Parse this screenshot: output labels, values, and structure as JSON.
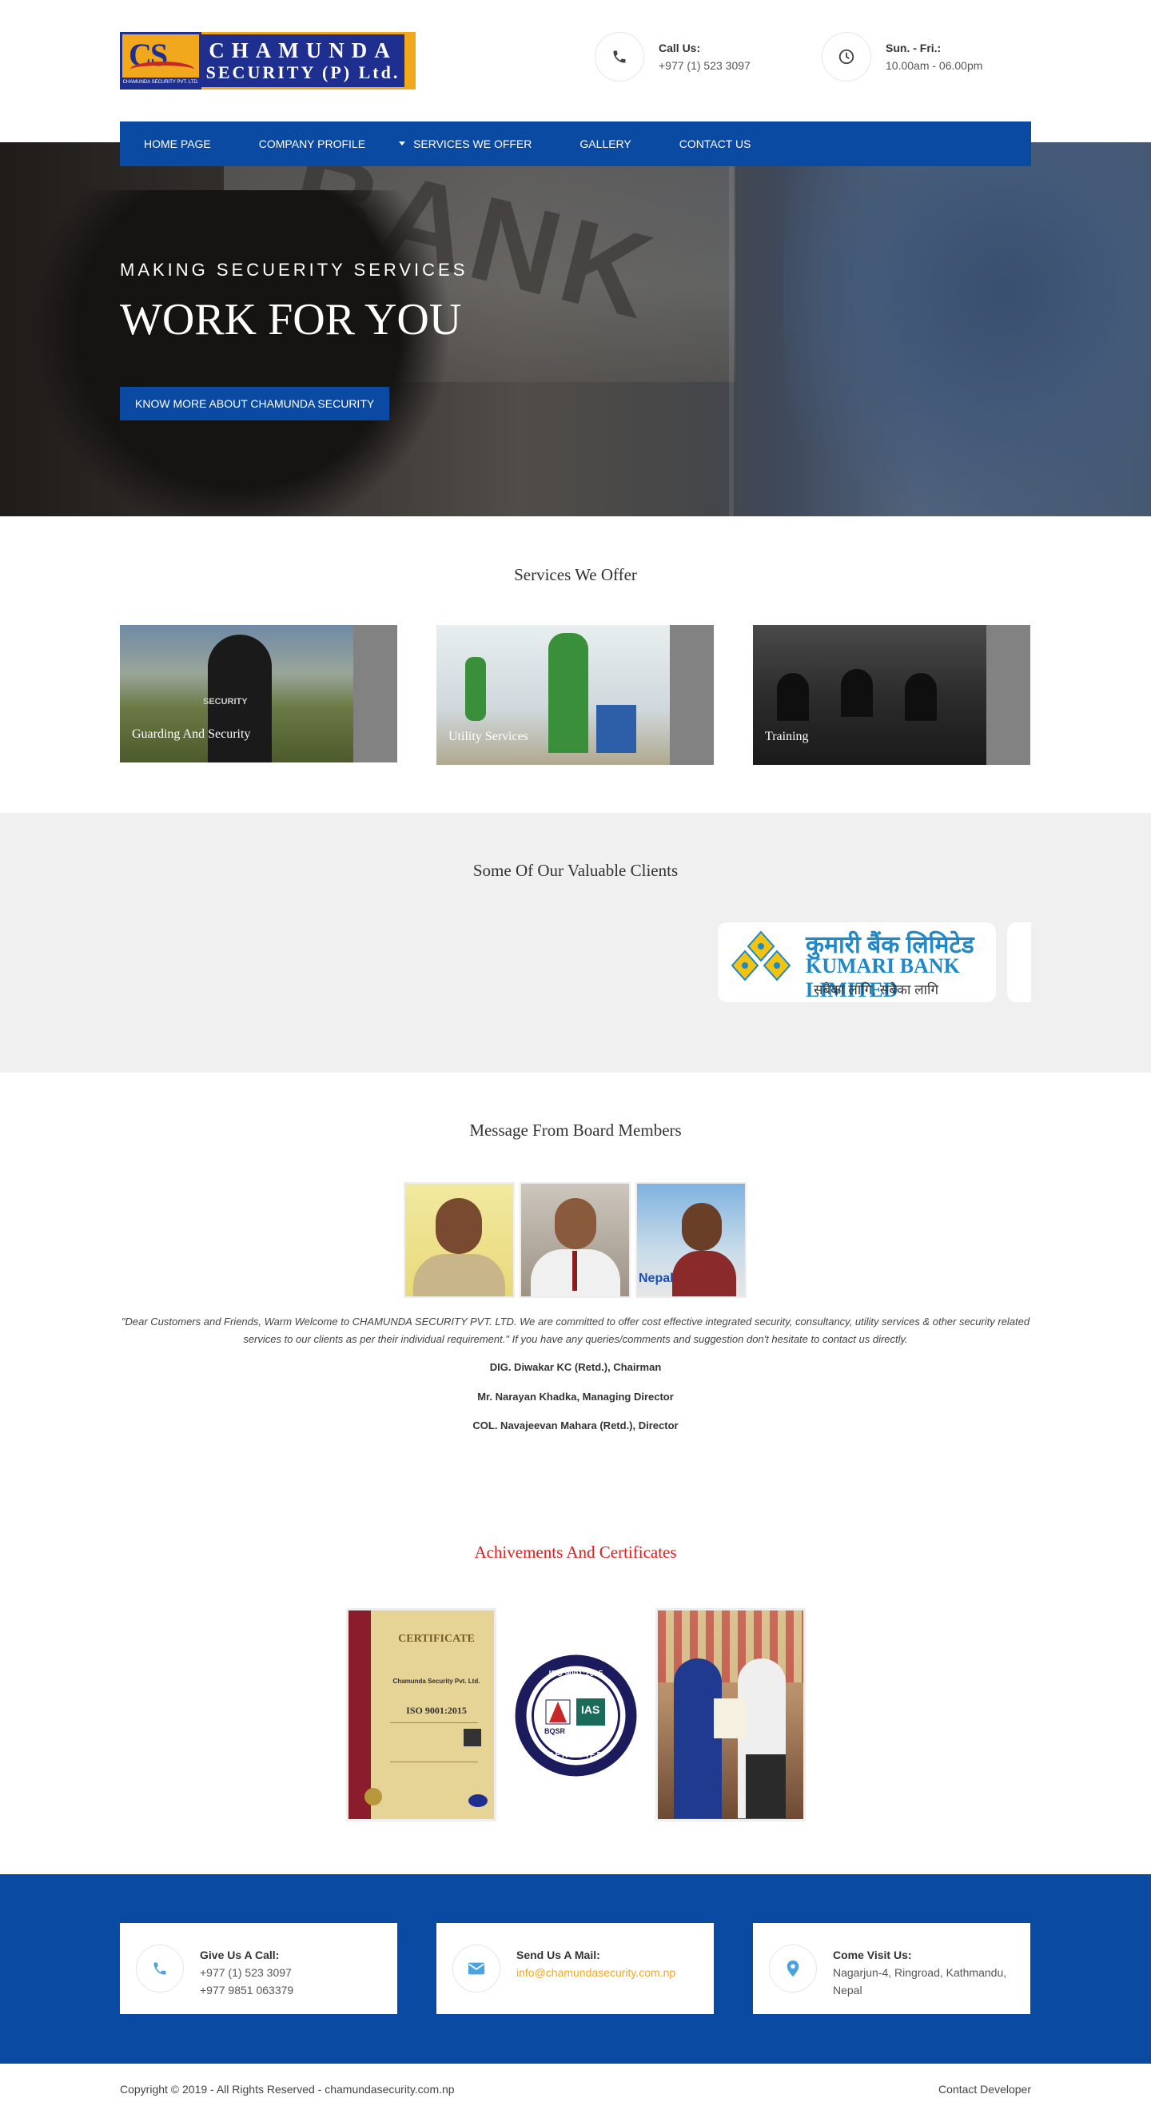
{
  "header": {
    "logo": {
      "mark": "CS",
      "line1": "CHAMUNDA",
      "line2": "SECURITY (P) Ltd.",
      "tag": "CHAMUNDA SECURITY PVT. LTD."
    },
    "call": {
      "title": "Call Us:",
      "value": "+977 (1) 523 3097",
      "icon": "phone-icon"
    },
    "hours": {
      "title": "Sun. - Fri.:",
      "value": "10.00am - 06.00pm",
      "icon": "clock-icon"
    }
  },
  "nav": {
    "items": [
      "HOME PAGE",
      "COMPANY PROFILE",
      "SERVICES WE OFFER",
      "GALLERY",
      "CONTACT US"
    ]
  },
  "hero": {
    "subtitle": "MAKING SECUERITY SERVICES",
    "title": "WORK FOR YOU",
    "cta": "KNOW MORE ABOUT CHAMUNDA SECURITY"
  },
  "services": {
    "title": "Services We Offer",
    "items": [
      "Guarding And Security",
      "Utility Services",
      "Training"
    ]
  },
  "clients": {
    "title": "Some Of Our Valuable Clients",
    "kumari": {
      "top": "कुमारी बैंक लिमिटेड",
      "name": "KUMARI BANK LIMITED",
      "slogan": "सबैका लागि, सबैका लागि"
    }
  },
  "board": {
    "title": "Message From Board Members",
    "quote": "\"Dear Customers and Friends, Warm Welcome to CHAMUNDA SECURITY PVT. LTD. We are committed to offer cost effective integrated security, consultancy, utility services & other security related services to our clients as per their individual requirement.\" If you have any queries/comments and suggestion don't hesitate to contact us directly.",
    "members": [
      "DIG. Diwakar KC (Retd.), Chairman",
      "Mr. Narayan Khadka, Managing Director",
      "COL. Navajeevan Mahara (Retd.), Director"
    ]
  },
  "achievements": {
    "title": "Achivements And Certificates",
    "cert": {
      "heading": "CERTIFICATE",
      "company": "Chamunda Security Pvt. Ltd.",
      "std": "ISO 9001:2015"
    },
    "seal": {
      "top": "ISO 9001:2015",
      "bottom": "CERTIFIED",
      "left": "BQSR",
      "right": "IAS"
    }
  },
  "footer": {
    "call": {
      "title": "Give Us A Call:",
      "line1": "+977 (1) 523 3097",
      "line2": "+977 9851 063379"
    },
    "mail": {
      "title": "Send Us A Mail:",
      "line1": "info@chamundasecurity.com.np"
    },
    "visit": {
      "title": "Come Visit Us:",
      "line1": "Nagarjun-4, Ringroad, Kathmandu,",
      "line2": "Nepal"
    },
    "copyright": "Copyright © 2019 - All Rights Reserved - chamundasecurity.com.np",
    "developer": "Contact Developer"
  },
  "colors": {
    "primary": "#0a4aa3",
    "accent": "#f2a81d",
    "achievement_title": "#e01b1b"
  }
}
